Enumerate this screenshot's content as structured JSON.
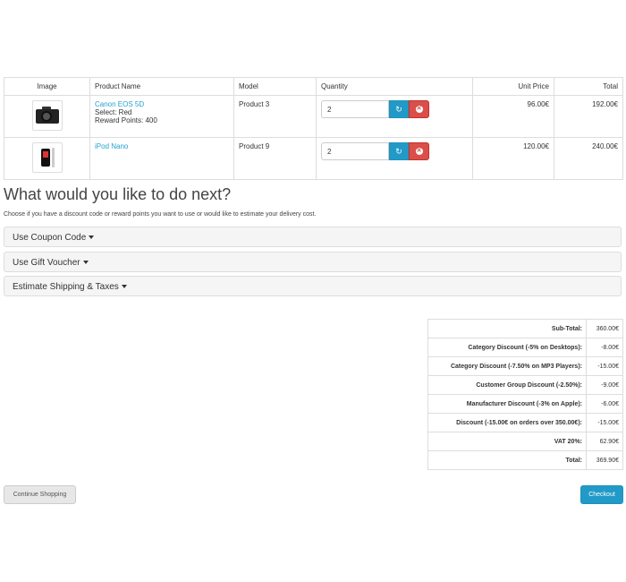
{
  "cart": {
    "headers": [
      "Image",
      "Product Name",
      "Model",
      "Quantity",
      "Unit Price",
      "Total"
    ],
    "rows": [
      {
        "image": "camera-icon",
        "name": "Canon EOS 5D",
        "option": "Select: Red",
        "reward": "Reward Points: 400",
        "model": "Product 3",
        "quantity": "2",
        "unit_price": "96.00€",
        "total": "192.00€"
      },
      {
        "image": "ipod-icon",
        "name": "iPod Nano",
        "model": "Product 9",
        "quantity": "2",
        "unit_price": "120.00€",
        "total": "240.00€"
      }
    ]
  },
  "next": {
    "title": "What would you like to do next?",
    "subtitle": "Choose if you have a discount code or reward points you want to use or would like to estimate your delivery cost.",
    "panels": [
      "Use Coupon Code",
      "Use Gift Voucher",
      "Estimate Shipping & Taxes"
    ]
  },
  "totals": [
    {
      "label": "Sub-Total:",
      "value": "360.00€"
    },
    {
      "label": "Category Discount (-5% on Desktops):",
      "value": "-8.00€"
    },
    {
      "label": "Category Discount (-7.50% on MP3 Players):",
      "value": "-15.00€"
    },
    {
      "label": "Customer Group Discount (-2.50%):",
      "value": "-9.00€"
    },
    {
      "label": "Manufacturer Discount (-3% on Apple):",
      "value": "-6.00€"
    },
    {
      "label": "Discount (-15.00€ on orders over 350.00€):",
      "value": "-15.00€"
    },
    {
      "label": "VAT 20%:",
      "value": "62.90€"
    },
    {
      "label": "Total:",
      "value": "369.90€"
    }
  ],
  "buttons": {
    "continue": "Continue Shopping",
    "checkout": "Checkout"
  },
  "colors": {
    "accent": "#229ac8",
    "danger": "#da4f49",
    "link": "#23a1d1"
  }
}
